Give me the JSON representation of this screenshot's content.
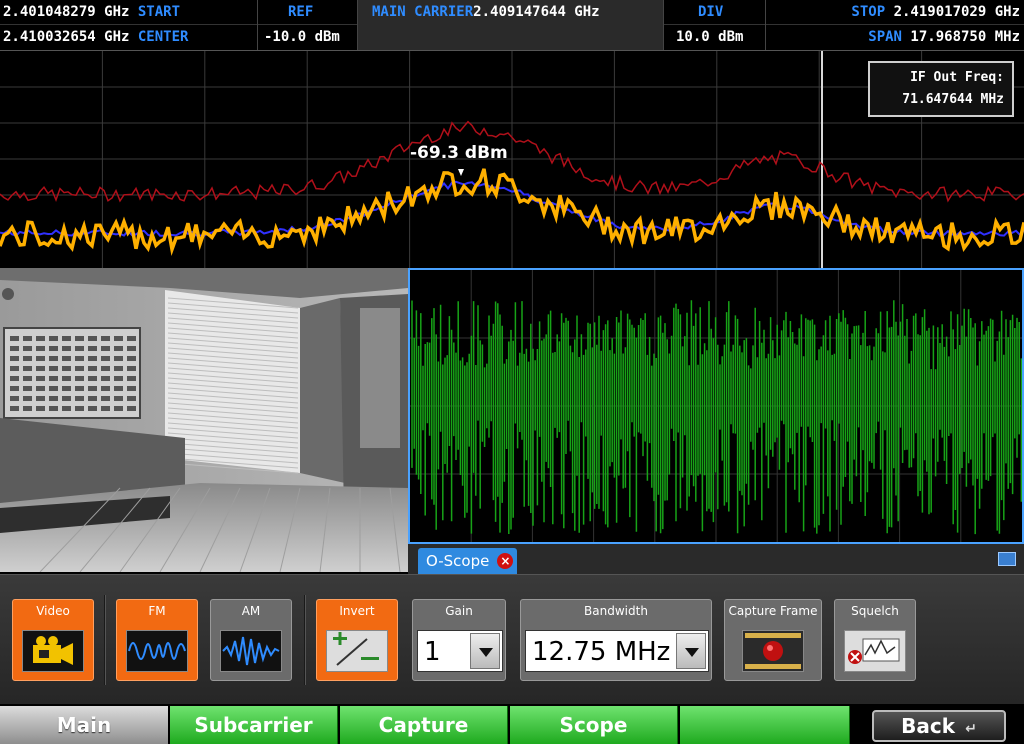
{
  "header": {
    "start_value": "2.401048279 GHz",
    "start_label": "START",
    "center_value": "2.410032654 GHz",
    "center_label": "CENTER",
    "ref_label": "REF",
    "ref_value": "-10.0 dBm",
    "main_carrier_label": "MAIN CARRIER",
    "main_carrier_value": "2.409147644 GHz",
    "div_label": "DIV",
    "div_value": "10.0 dBm",
    "stop_label": "STOP",
    "stop_value": "2.419017029 GHz",
    "span_label": "SPAN",
    "span_value": "17.968750 MHz"
  },
  "spectrum": {
    "if_out_label": "IF Out Freq:",
    "if_out_value": "71.647644 MHz",
    "marker_value": "-69.3 dBm",
    "colors": {
      "max_hold": "#b0101a",
      "live": "#ffb000",
      "average": "#3030ff"
    }
  },
  "scope": {
    "tab_label": "O-Scope",
    "trace_color": "#17a317"
  },
  "controls": {
    "video_label": "Video",
    "fm_label": "FM",
    "am_label": "AM",
    "invert_label": "Invert",
    "gain_label": "Gain",
    "gain_value": "1",
    "bandwidth_label": "Bandwidth",
    "bandwidth_value": "12.75 MHz",
    "capture_frame_label": "Capture Frame",
    "squelch_label": "Squelch",
    "icons": [
      "video-camera-icon",
      "fm-wave-icon",
      "am-wave-icon",
      "invert-icon",
      "record-film-icon",
      "squelch-icon"
    ]
  },
  "nav": {
    "main_label": "Main",
    "subcarrier_label": "Subcarrier",
    "capture_label": "Capture",
    "scope_label": "Scope",
    "back_label": "Back"
  }
}
